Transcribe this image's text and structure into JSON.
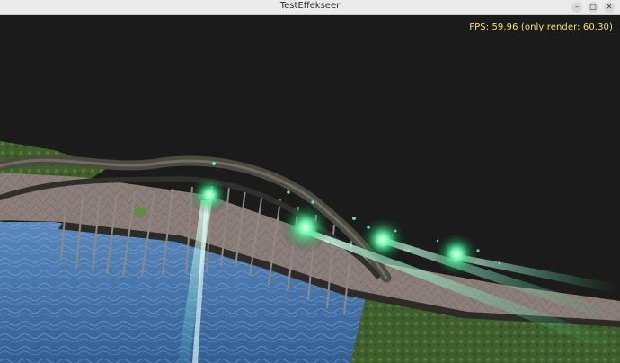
{
  "window": {
    "title": "TestEffekseer",
    "controls": {
      "minimize": "–",
      "maximize": "□",
      "close": "✕"
    }
  },
  "overlay": {
    "fps_text": "FPS: 59.96 (only render: 60.30)"
  },
  "colors": {
    "background": "#1b1b1b",
    "fps_text": "#f1e35a",
    "effect_glow": "#4dff9a",
    "water": "#4f7fb3",
    "grass": "#3f5f2c",
    "bridge_deck": "#8f7f7a",
    "bridge_arch": "#4a4a40"
  },
  "icons": [
    "minimize-icon",
    "maximize-icon",
    "close-icon"
  ]
}
